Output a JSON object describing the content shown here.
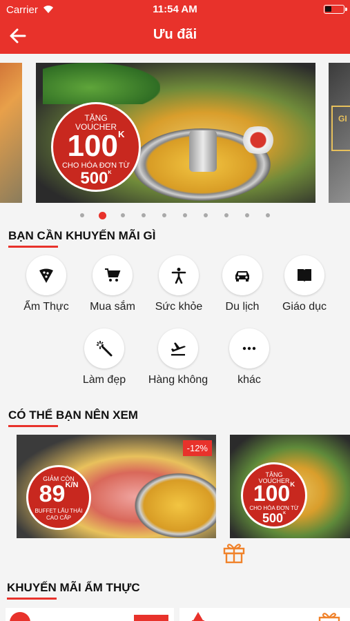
{
  "status_bar": {
    "carrier": "Carrier",
    "time": "11:54 AM"
  },
  "header": {
    "title": "Ưu đãi"
  },
  "banner": {
    "badge_line1": "TẶNG",
    "badge_line2": "VOUCHER",
    "badge_value": "100",
    "badge_value_unit": "K",
    "badge_line3": "CHO HÓA ĐƠN TỪ",
    "badge_min": "500",
    "badge_min_unit": "K",
    "right_peek_text": "GI"
  },
  "carousel": {
    "count": 10,
    "active_index": 1
  },
  "sections": {
    "promo_types": "BẠN CẦN KHUYẾN MÃI GÌ",
    "suggested": "CÓ THỂ BẠN NÊN XEM",
    "food_promos": "KHUYẾN MÃI ẨM THỰC"
  },
  "categories": [
    {
      "label": "Ẩm Thực",
      "icon": "pizza-icon"
    },
    {
      "label": "Mua sắm",
      "icon": "cart-icon"
    },
    {
      "label": "Sức khỏe",
      "icon": "person-icon"
    },
    {
      "label": "Du lịch",
      "icon": "car-icon"
    },
    {
      "label": "Giáo dục",
      "icon": "book-icon"
    },
    {
      "label": "Làm đẹp",
      "icon": "magic-wand-icon"
    },
    {
      "label": "Hàng không",
      "icon": "plane-takeoff-icon"
    },
    {
      "label": "khác",
      "icon": "more-icon"
    }
  ],
  "cards": [
    {
      "discount": "-12%",
      "badge_line1": "GIẢM CÒN",
      "badge_value": "89",
      "badge_value_unit": "K/N",
      "badge_line3": "BUFFET LẨU THÁI",
      "badge_line4": "CAO CẤP"
    },
    {
      "badge_line1": "TẶNG",
      "badge_line2": "VOUCHER",
      "badge_value": "100",
      "badge_value_unit": "K",
      "badge_line3": "CHO HÓA ĐƠN TỪ",
      "badge_min": "500",
      "badge_min_unit": "K"
    }
  ],
  "colors": {
    "brand_red": "#e8322b",
    "gift_orange": "#f0822a"
  }
}
